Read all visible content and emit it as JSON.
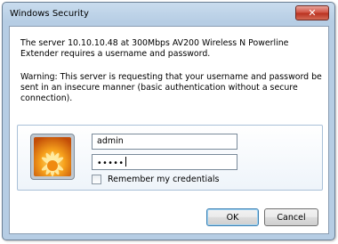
{
  "window": {
    "title": "Windows Security",
    "close_symbol": "✕"
  },
  "message": {
    "line_server": "The server 10.10.10.48 at 300Mbps AV200 Wireless N Powerline Extender requires a username and password.",
    "warning": "Warning: This server is requesting that your username and password be sent in an insecure manner (basic authentication without a secure connection)."
  },
  "credentials": {
    "username": "admin",
    "password_masked": "•••••",
    "remember_label": "Remember my credentials",
    "remember_checked": false,
    "user_tile_icon": "flower-user-tile-icon"
  },
  "buttons": {
    "ok": "OK",
    "cancel": "Cancel"
  },
  "colors": {
    "frame": "#b6cde4",
    "close_button": "#c8453a",
    "default_button_border": "#3c7fb1"
  }
}
